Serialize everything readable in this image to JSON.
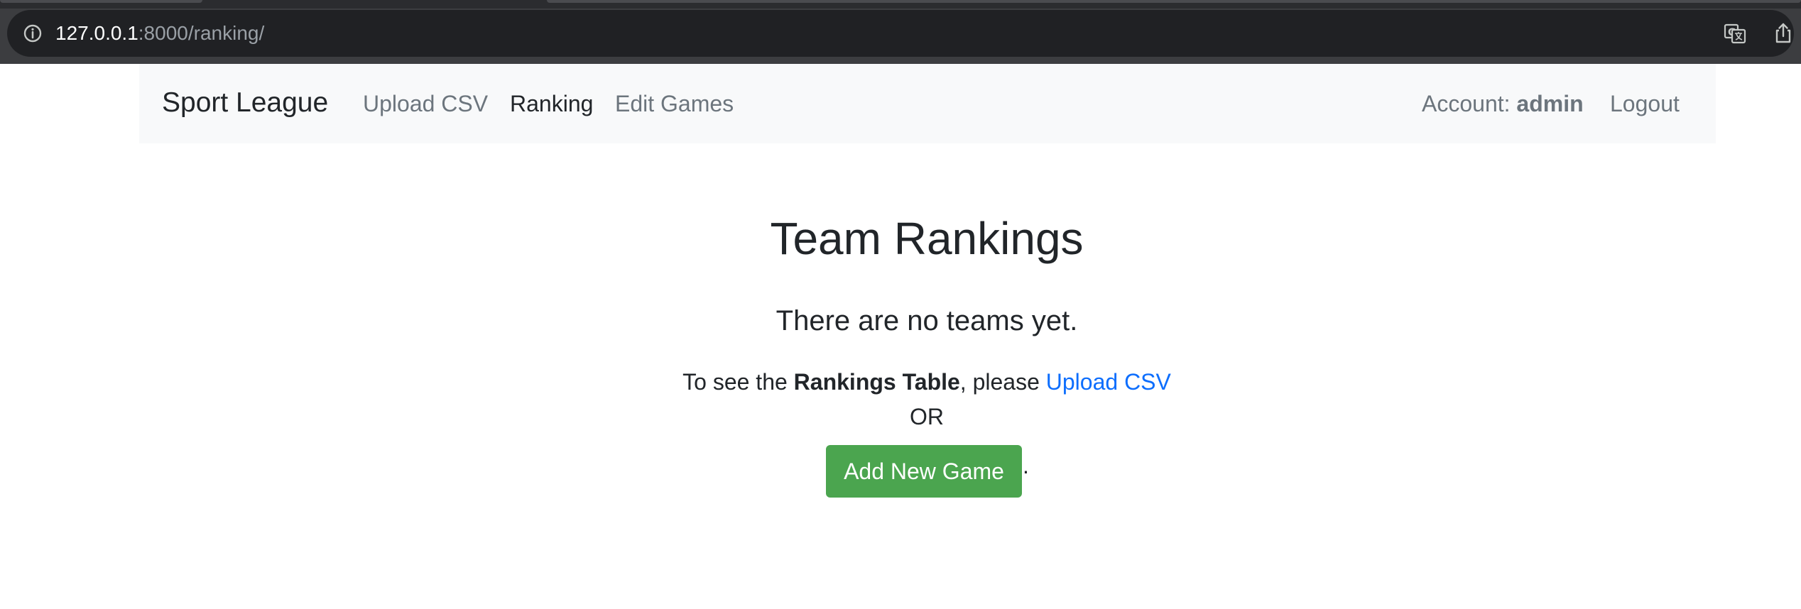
{
  "browser": {
    "url_host": "127.0.0.1",
    "url_rest": ":8000/ranking/",
    "icons": [
      "info-icon",
      "translate-icon",
      "share-icon"
    ]
  },
  "navbar": {
    "brand": "Sport League",
    "links": [
      {
        "label": "Upload CSV",
        "active": false
      },
      {
        "label": "Ranking",
        "active": true
      },
      {
        "label": "Edit Games",
        "active": false
      }
    ],
    "account_label": "Account:",
    "account_user": "admin",
    "logout_label": "Logout"
  },
  "main": {
    "title": "Team Rankings",
    "empty_message": "There are no teams yet.",
    "instruction_prefix": "To see the",
    "instruction_bold": "Rankings Table",
    "instruction_middle": ", please",
    "instruction_link": "Upload CSV",
    "or_text": "OR",
    "add_game_button": "Add New Game",
    "trailing_period": "."
  },
  "colors": {
    "chrome_bg": "#3c3d40",
    "omnibox_bg": "#202124",
    "navbar_bg": "#f8f9fa",
    "link_blue": "#0d6efd",
    "button_green": "#4ba54f",
    "text_dark": "#212529",
    "text_muted": "#6c757d"
  }
}
